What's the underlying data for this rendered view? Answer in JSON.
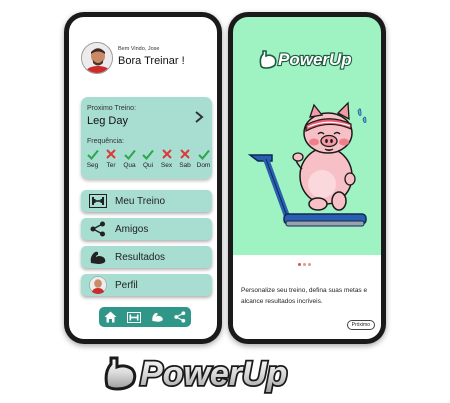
{
  "left_screen": {
    "welcome": "Bem Vindo, Jose",
    "greeting": "Bora Treinar !",
    "next_training": {
      "label": "Proximo Treino:",
      "value": "Leg Day"
    },
    "frequency": {
      "label": "Frequência:",
      "days": [
        {
          "label": "Seg",
          "done": true
        },
        {
          "label": "Ter",
          "done": false
        },
        {
          "label": "Qua",
          "done": true
        },
        {
          "label": "Qui",
          "done": true
        },
        {
          "label": "Sex",
          "done": false
        },
        {
          "label": "Sab",
          "done": false
        },
        {
          "label": "Dom",
          "done": true
        }
      ]
    },
    "menu": [
      {
        "label": "Meu Treino",
        "icon": "dumbbell-icon"
      },
      {
        "label": "Amigos",
        "icon": "share-icon"
      },
      {
        "label": "Resultados",
        "icon": "muscle-icon"
      },
      {
        "label": "Perfil",
        "icon": "avatar-icon"
      }
    ],
    "bottom_nav": [
      "home-icon",
      "dumbbell-icon",
      "muscle-icon",
      "share-icon"
    ]
  },
  "right_screen": {
    "logo": "PowerUp",
    "description": "Personalize seu treino, defina suas metas e alcance resultados incríveis.",
    "next_button": "Próximo"
  },
  "brand": {
    "name": "PowerUp"
  },
  "colors": {
    "card": "#a8ddd2",
    "nav": "#2f9688",
    "check": "#2aa84a",
    "cross": "#d93a3a",
    "onboarding_bg": "#9ff2c2"
  }
}
